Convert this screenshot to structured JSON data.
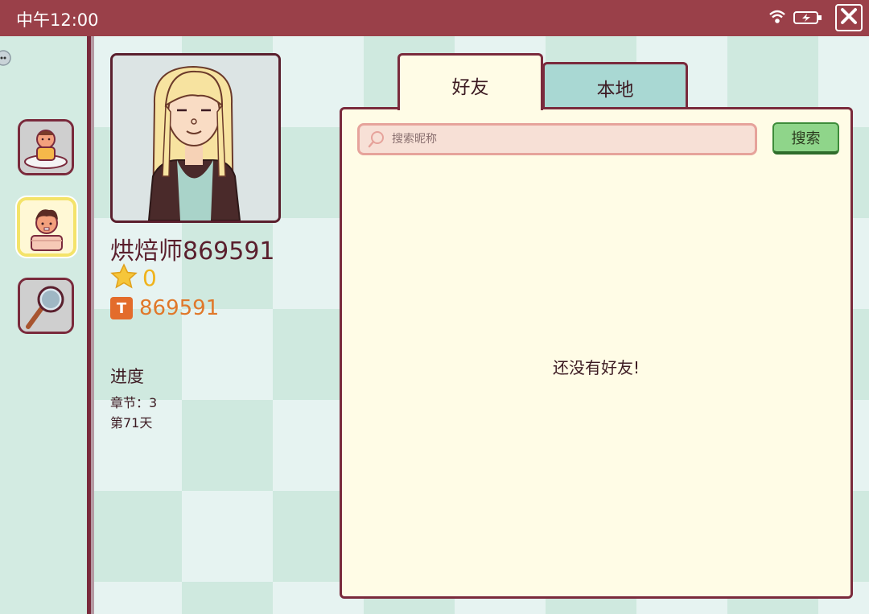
{
  "status_bar": {
    "time": "中午12:00",
    "icons": [
      "wifi-icon",
      "battery-charging-icon",
      "close-icon"
    ]
  },
  "left_nav": {
    "items": [
      {
        "name": "chef-character",
        "icon": "chef-avatar-icon"
      },
      {
        "name": "profile",
        "icon": "boy-avatar-icon",
        "active": true
      },
      {
        "name": "search",
        "icon": "magnifier-icon"
      }
    ]
  },
  "profile": {
    "name": "烘焙师869591",
    "stars": "0",
    "id": "869591",
    "id_badge": "T",
    "progress_title": "进度",
    "chapter": "章节：3",
    "day": "第71天"
  },
  "tabs": [
    {
      "label": "好友",
      "active": true
    },
    {
      "label": "本地",
      "active": false
    }
  ],
  "search": {
    "placeholder": "搜索昵称",
    "button_label": "搜索"
  },
  "empty_message": "还没有好友!",
  "colors": {
    "topbar": "#9a4049",
    "border": "#7a2a3c",
    "panel_bg": "#fffce6",
    "search_button": "#8fd58a"
  }
}
